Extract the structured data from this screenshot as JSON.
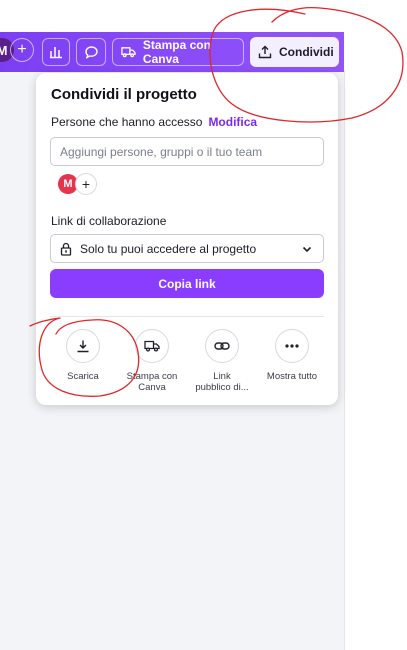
{
  "topbar": {
    "avatar_initial": "M",
    "print_label": "Stampa con Canva",
    "share_label": "Condividi"
  },
  "share_panel": {
    "title": "Condividi il progetto",
    "access_label": "Persone che hanno accesso",
    "modify_link": "Modifica",
    "invite_placeholder": "Aggiungi persone, gruppi o il tuo team",
    "member_initial": "M",
    "link_section_label": "Link di collaborazione",
    "permission_value": "Solo tu puoi accedere al progetto",
    "copy_link_label": "Copia link",
    "actions": [
      {
        "label": "Scarica",
        "icon": "download-icon"
      },
      {
        "label": "Stampa con Canva",
        "icon": "truck-icon"
      },
      {
        "label": "Link pubblico di...",
        "icon": "link-icon"
      },
      {
        "label": "Mostra tutto",
        "icon": "more-icon"
      }
    ]
  },
  "colors": {
    "accent": "#8b3dff",
    "topbar": "#7b3ff2",
    "annotation_red": "#e0262a"
  }
}
